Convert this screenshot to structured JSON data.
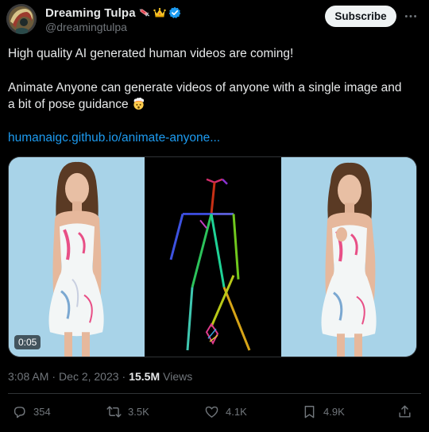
{
  "author": {
    "display_name": "Dreaming Tulpa",
    "handle": "@dreamingtulpa",
    "name_emojis": [
      "syringe-emoji",
      "crown-emoji",
      "verified-badge-icon"
    ]
  },
  "header": {
    "subscribe_label": "Subscribe",
    "more_icon": "more-horizontal-icon"
  },
  "tweet": {
    "line1": "High quality AI generated human videos are coming!",
    "line2": "Animate Anyone can generate videos of anyone with a single image and",
    "line3": "a bit of pose guidance",
    "line3_emoji": "exploding-head-emoji",
    "link": "humanaigc.github.io/animate-anyone..."
  },
  "media": {
    "duration": "0:05",
    "panels": [
      "reference-image",
      "pose-skeleton",
      "generated-frame"
    ]
  },
  "meta": {
    "time": "3:08 AM",
    "separator": "·",
    "date": "Dec 2, 2023",
    "views_count": "15.5M",
    "views_label": "Views"
  },
  "actions": {
    "replies": "354",
    "reposts": "3.5K",
    "likes": "4.1K",
    "bookmarks": "4.9K"
  },
  "colors": {
    "background": "#000000",
    "text": "#e7e9ea",
    "muted": "#71767b",
    "link": "#1d9bf0",
    "verified": "#1d9bf0",
    "subscribe_bg": "#eff3f4"
  }
}
